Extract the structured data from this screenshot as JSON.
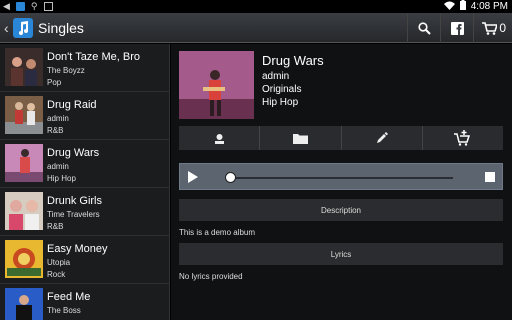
{
  "status_bar": {
    "time": "4:08 PM",
    "icons": [
      "back-arrow-icon",
      "app-icon",
      "usb-icon",
      "image-icon",
      "wifi-icon",
      "battery-icon"
    ]
  },
  "action_bar": {
    "title": "Singles",
    "cart_count": "0",
    "icons": [
      "back-chevron-icon",
      "music-app-icon",
      "search-icon",
      "facebook-icon",
      "cart-icon"
    ]
  },
  "songs": [
    {
      "title": "Don't Taze Me, Bro",
      "artist": "The Boyzz",
      "genre": "Pop"
    },
    {
      "title": "Drug Raid",
      "artist": "admin",
      "genre": "R&B"
    },
    {
      "title": "Drug Wars",
      "artist": "admin",
      "genre": "Hip Hop"
    },
    {
      "title": "Drunk Girls",
      "artist": "Time Travelers",
      "genre": "R&B"
    },
    {
      "title": "Easy Money",
      "artist": "Utopia",
      "genre": "Rock"
    },
    {
      "title": "Feed Me",
      "artist": "The Boss",
      "genre": ""
    }
  ],
  "detail": {
    "title": "Drug Wars",
    "artist": "admin",
    "album": "Originals",
    "genre": "Hip Hop",
    "toolbar_icons": [
      "artist-icon",
      "folder-icon",
      "edit-icon",
      "add-to-cart-icon"
    ],
    "player": {
      "progress": 0.0
    },
    "description_header": "Description",
    "description_text": "This is a demo album",
    "lyrics_header": "Lyrics",
    "lyrics_text": "No lyrics provided"
  },
  "colors": {
    "accent": "#2a86d6",
    "player_bg": "#5c6470"
  }
}
